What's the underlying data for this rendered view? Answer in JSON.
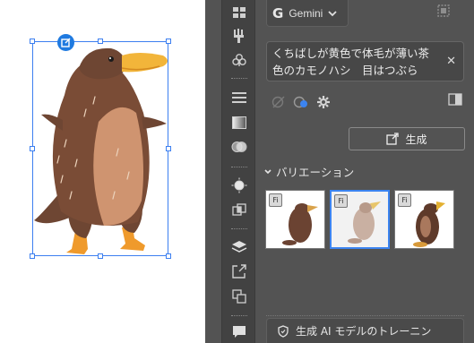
{
  "canvas": {
    "subject": "platypus-illustration"
  },
  "panel": {
    "model": {
      "logo": "G",
      "label": "Gemini",
      "icon": "chevron-down-icon"
    },
    "prompt": {
      "value": "くちばしが黄色で体毛が薄い茶色のカモノハシ　目はつぶら　人間のように二足歩行で立っている"
    },
    "generate_label": "生成",
    "variations_label": "バリエーション",
    "variations": [
      {
        "badge": "Fi",
        "selected": false,
        "tone": "dark"
      },
      {
        "badge": "Fi",
        "selected": true,
        "tone": "faded"
      },
      {
        "badge": "Fi",
        "selected": false,
        "tone": "dark"
      }
    ],
    "training_label": "生成 AI モデルのトレーニン"
  },
  "toolbar": {
    "tools": [
      "grid-icon",
      "brush-icon",
      "club-icon",
      "menu-icon",
      "gradient-icon",
      "overlap-circles-icon",
      "sun-icon",
      "crop-icon",
      "layers-icon",
      "export-icon",
      "artboards-icon",
      "comment-icon"
    ]
  },
  "colors": {
    "selection": "#3c7ff0",
    "panel_bg": "#535353",
    "toolbar_bg": "#424242",
    "accent": "#3c84f0"
  }
}
